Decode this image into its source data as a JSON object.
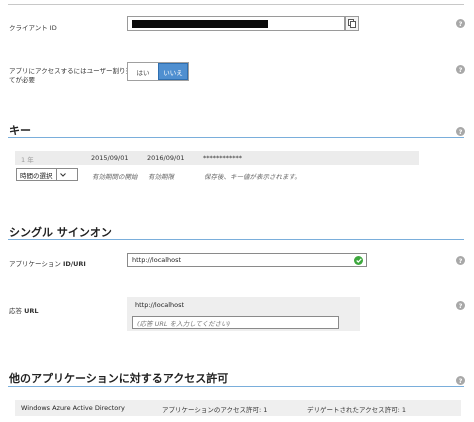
{
  "client_id": {
    "label": "クライアント ID"
  },
  "access_assignment": {
    "label_line1": "アプリにアクセスするにはユーザー割り当",
    "label_line2": "てが必要",
    "option_yes": "はい",
    "option_no": "いいえ",
    "selected": "いいえ"
  },
  "keys": {
    "title": "キー",
    "row": {
      "duration": "1 年",
      "start": "2015/09/01",
      "end": "2016/09/01",
      "value": "************"
    },
    "new_row": {
      "select_label": "時間の選択",
      "start_placeholder": "有効期間の開始",
      "end_placeholder": "有効期限",
      "value_hint": "保存後、キー値が表示されます。"
    }
  },
  "sso": {
    "title": "シングル サインオン",
    "app_id_label_prefix": "アプリケーション",
    "app_id_label_strong": "ID/URI",
    "app_id_value": "http://localhost",
    "reply_label_prefix": "応答",
    "reply_label_strong": "URL",
    "reply_url_value": "http://localhost",
    "reply_url_placeholder": "(応答 URL を入力してください)"
  },
  "permissions": {
    "title": "他のアプリケーションに対するアクセス許可",
    "row": {
      "app_name": "Windows Azure Active Directory",
      "app_permissions": "アプリケーションのアクセス許可: 1",
      "delegated_permissions": "デリゲートされたアクセス許可: 1"
    }
  },
  "icons": {
    "help": "help-icon",
    "copy": "copy-icon",
    "check": "check-icon",
    "chevron": "chevron-down-icon"
  },
  "colors": {
    "accent": "#4f8fd0",
    "section_rule": "#7aaedb",
    "valid": "#3ea83e"
  }
}
